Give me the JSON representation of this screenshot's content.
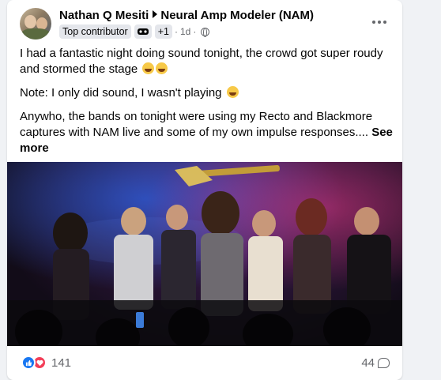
{
  "post": {
    "author": "Nathan Q Mesiti",
    "group": "Neural Amp Modeler (NAM)",
    "badge": "Top contributor",
    "badge_extra": "+1",
    "separator": "·",
    "time": "1d",
    "paragraphs": [
      "I had a fantastic night doing sound tonight, the crowd got super roudy and stormed the stage",
      "Note: I only did sound, I wasn't playing",
      "Anywho, the bands on tonight were using my Recto and Blackmore captures with NAM live and some of my own impulse responses...."
    ],
    "see_more": "See more",
    "icons": {
      "more": "more-horizontal-icon",
      "globe": "globe-icon",
      "badge2": "community-badge-icon",
      "like": "like-reaction-icon",
      "love": "love-reaction-icon",
      "comment": "comment-icon"
    }
  },
  "footer": {
    "reactions": "141",
    "comments": "44"
  },
  "colors": {
    "accent": "#1877f2",
    "love": "#f33e58",
    "meta": "#65676b"
  }
}
